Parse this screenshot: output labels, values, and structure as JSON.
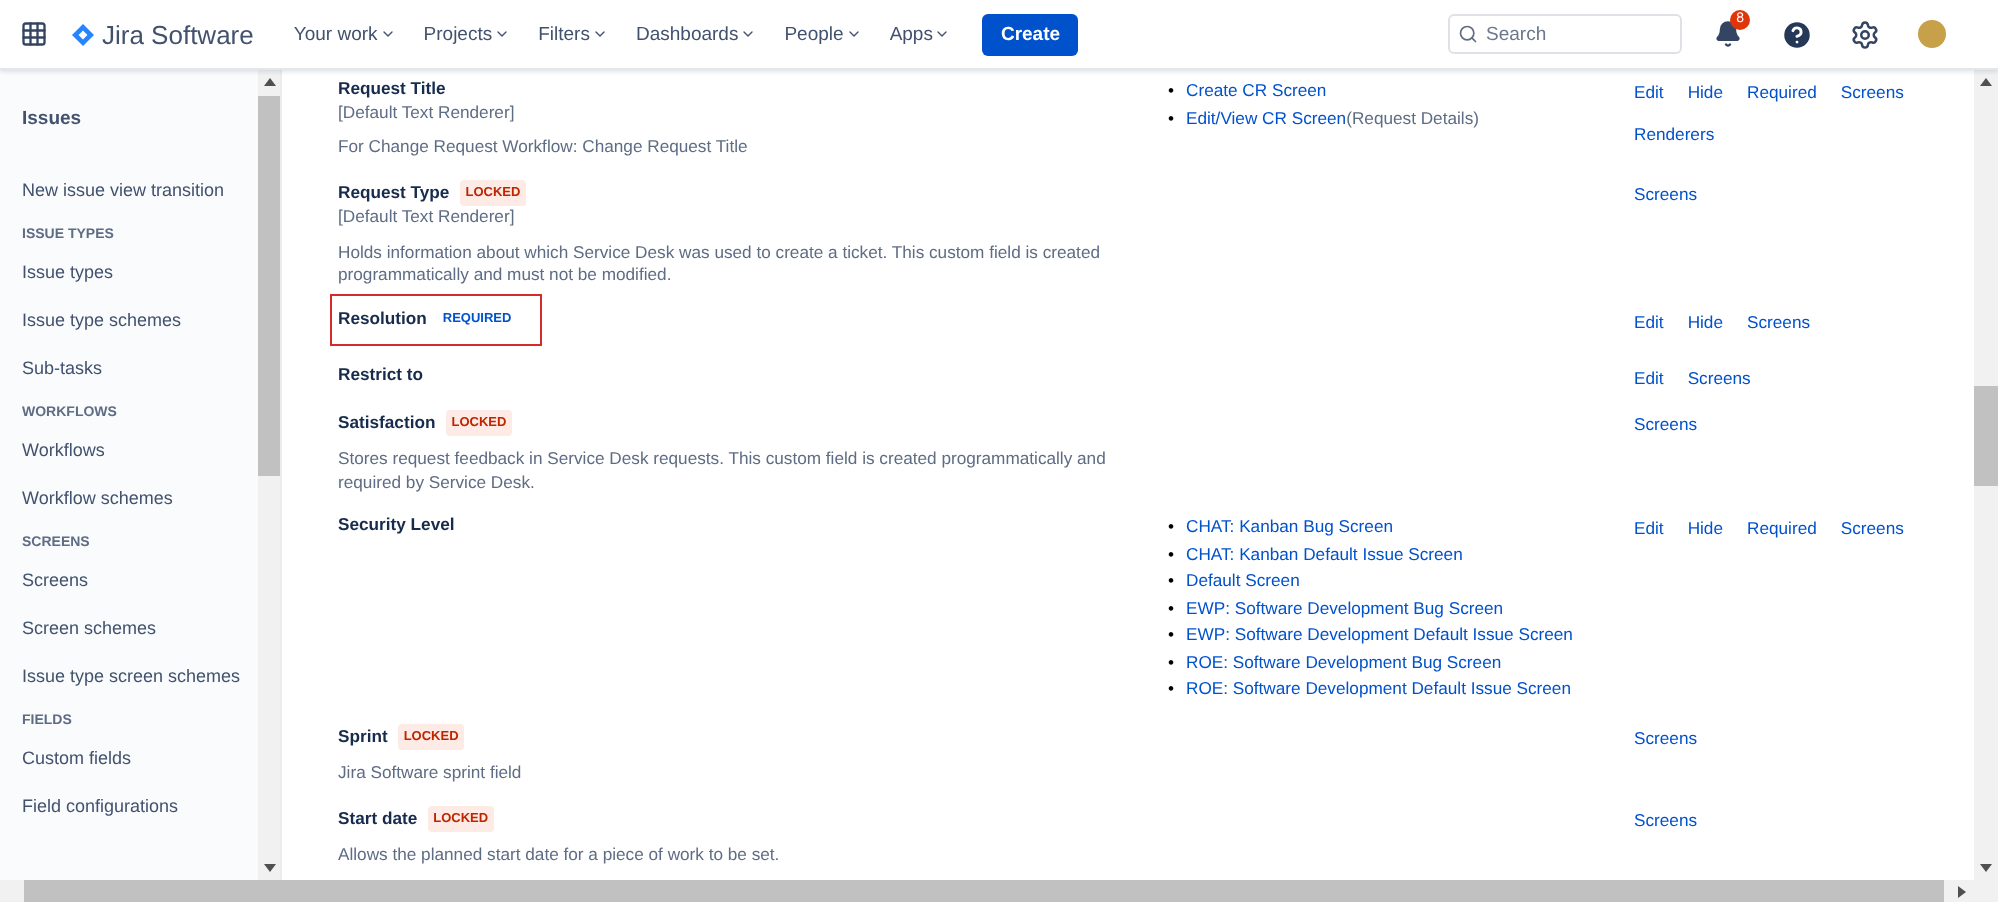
{
  "header": {
    "product": "Jira Software",
    "nav": [
      {
        "label": "Your work"
      },
      {
        "label": "Projects"
      },
      {
        "label": "Filters"
      },
      {
        "label": "Dashboards"
      },
      {
        "label": "People"
      },
      {
        "label": "Apps"
      }
    ],
    "create_button": "Create",
    "search": {
      "placeholder": "Search"
    },
    "notification_count": "8"
  },
  "sidebar": {
    "title": "Issues",
    "sections": [
      {
        "items": [
          "New issue view transition"
        ]
      },
      {
        "heading": "ISSUE TYPES",
        "items": [
          "Issue types",
          "Issue type schemes",
          "Sub-tasks"
        ]
      },
      {
        "heading": "WORKFLOWS",
        "items": [
          "Workflows",
          "Workflow schemes"
        ]
      },
      {
        "heading": "SCREENS",
        "items": [
          "Screens",
          "Screen schemes",
          "Issue type screen schemes"
        ]
      },
      {
        "heading": "FIELDS",
        "items": [
          "Custom fields",
          "Field configurations"
        ]
      }
    ]
  },
  "fields": [
    {
      "name": "Request Title",
      "renderer": "[Default Text Renderer]",
      "description": "For Change Request Workflow: Change Request Title",
      "highlighted": false,
      "screens": [
        {
          "marker": "•",
          "label": "Create CR Screen"
        },
        {
          "marker": "•",
          "label": "Edit/View CR Screen",
          "note": "(Request Details)"
        }
      ],
      "operations": [
        "Edit",
        "Hide",
        "Required",
        "Screens",
        "Renderers"
      ]
    },
    {
      "name": "Request Type",
      "badge": {
        "kind": "locked",
        "label": "LOCKED"
      },
      "renderer": "[Default Text Renderer]",
      "description": "Holds information about which Service Desk was used to create a ticket. This custom field is created programmatically and must not be modified.",
      "highlighted": false,
      "operations": [
        "Screens"
      ]
    },
    {
      "name": "Resolution",
      "badge": {
        "kind": "required",
        "label": "REQUIRED"
      },
      "highlighted": true,
      "operations": [
        "Edit",
        "Hide",
        "Screens"
      ]
    },
    {
      "name": "Restrict to",
      "highlighted": false,
      "operations": [
        "Edit",
        "Screens"
      ]
    },
    {
      "name": "Satisfaction",
      "badge": {
        "kind": "locked",
        "label": "LOCKED"
      },
      "description": "Stores request feedback in Service Desk requests. This custom field is created programmatically and required by Service Desk.",
      "highlighted": false,
      "operations": [
        "Screens"
      ]
    },
    {
      "name": "Security Level",
      "highlighted": false,
      "screens": [
        {
          "marker": "•",
          "label": "CHAT: Kanban Bug Screen"
        },
        {
          "marker": "•",
          "label": "CHAT: Kanban Default Issue Screen"
        },
        {
          "marker": "•",
          "label": "Default Screen"
        },
        {
          "marker": "•",
          "label": "EWP: Software Development Bug Screen"
        },
        {
          "marker": "•",
          "label": "EWP: Software Development Default Issue Screen"
        },
        {
          "marker": "•",
          "label": "ROE: Software Development Bug Screen"
        },
        {
          "marker": "•",
          "label": "ROE: Software Development Default Issue Screen"
        }
      ],
      "operations": [
        "Edit",
        "Hide",
        "Required",
        "Screens"
      ]
    },
    {
      "name": "Sprint",
      "badge": {
        "kind": "locked",
        "label": "LOCKED"
      },
      "description": "Jira Software sprint field",
      "highlighted": false,
      "operations": [
        "Screens"
      ]
    },
    {
      "name": "Start date",
      "badge": {
        "kind": "locked",
        "label": "LOCKED"
      },
      "description": "Allows the planned start date for a piece of work to be set.",
      "highlighted": false,
      "operations": [
        "Screens"
      ]
    }
  ]
}
